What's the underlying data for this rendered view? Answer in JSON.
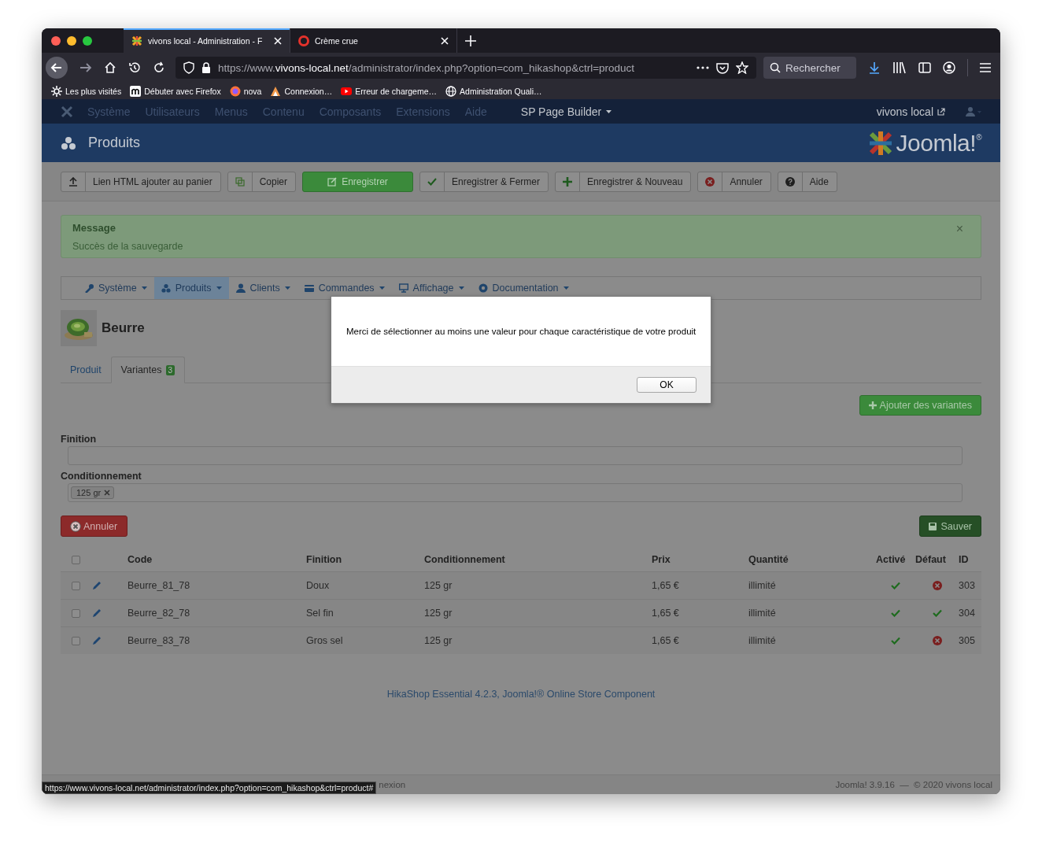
{
  "browser": {
    "tabs": [
      {
        "title": "vivons local - Administration - F",
        "selected": true
      },
      {
        "title": "Crème crue",
        "selected": false
      }
    ],
    "url": "https://www.**vivons-local.net**/administrator/index.php?option=com_hikashop&ctrl=product",
    "search": {
      "placeholder": "Rechercher"
    },
    "bookmarks": [
      "Les plus visités",
      "Débuter avec Firefox",
      "nova",
      "Connexion…",
      "Erreur de chargeme…",
      "Administration Quali…"
    ]
  },
  "admin_menu": {
    "items": [
      {
        "label": "Système",
        "disabled": true,
        "dropdown": false
      },
      {
        "label": "Utilisateurs",
        "disabled": true,
        "dropdown": false
      },
      {
        "label": "Menus",
        "disabled": true,
        "dropdown": false
      },
      {
        "label": "Contenu",
        "disabled": true,
        "dropdown": false
      },
      {
        "label": "Composants",
        "disabled": true,
        "dropdown": false
      },
      {
        "label": "Extensions",
        "disabled": true,
        "dropdown": false
      },
      {
        "label": "Aide",
        "disabled": true,
        "dropdown": false
      },
      {
        "label": "SP Page Builder",
        "disabled": false,
        "dropdown": true
      }
    ],
    "site_link": "vivons local"
  },
  "header": {
    "title": "Produits",
    "logo": "Joomla!$^{®}$"
  },
  "toolbar": [
    {
      "label": "Lien HTML ajouter au panier",
      "kind": "default"
    },
    {
      "label": "Copier",
      "kind": "default"
    },
    {
      "label": "Enregistrer",
      "kind": "primary"
    },
    {
      "label": "Enregistrer & Fermer",
      "kind": "default"
    },
    {
      "label": "Enregistrer & Nouveau",
      "kind": "default"
    },
    {
      "label": "Annuler",
      "kind": "default"
    },
    {
      "label": "Aide",
      "kind": "default"
    }
  ],
  "message": {
    "heading": "Message",
    "text": "Succès de la sauvegarde",
    "close": "×"
  },
  "submenu": [
    {
      "label": "Système",
      "selected": false
    },
    {
      "label": "Produits",
      "selected": true
    },
    {
      "label": "Clients",
      "selected": false
    },
    {
      "label": "Commandes",
      "selected": false
    },
    {
      "label": "Affichage",
      "selected": false
    },
    {
      "label": "Documentation",
      "selected": false
    }
  ],
  "product": {
    "name": "Beurre"
  },
  "tabs": [
    {
      "label": "Produit",
      "selected": false
    },
    {
      "label": "Variantes",
      "selected": true,
      "badge": "3"
    }
  ],
  "add_variants_button": "Ajouter des variantes",
  "characteristics": [
    {
      "label": "Finition"
    },
    {
      "label": "Conditionnement",
      "tags": [
        "125 gr"
      ]
    }
  ],
  "cancel_button": "Annuler",
  "save_button": "Sauver",
  "table": {
    "all_checked": false,
    "columns": [
      "Code",
      "Finition",
      "Conditionnement",
      "Prix",
      "Quantité",
      "Activé",
      "Défaut",
      "ID"
    ],
    "rows": [
      {
        "checked": false,
        "code": "Beurre_81_78",
        "finition": "Doux",
        "conditionnement": "125 gr",
        "prix": "1,65 €",
        "quantite": "illimité",
        "active": true,
        "default": false,
        "id": "303"
      },
      {
        "checked": false,
        "code": "Beurre_82_78",
        "finition": "Sel fin",
        "conditionnement": "125 gr",
        "prix": "1,65 €",
        "quantite": "illimité",
        "active": true,
        "default": true,
        "id": "304"
      },
      {
        "checked": false,
        "code": "Beurre_83_78",
        "finition": "Gros sel",
        "conditionnement": "125 gr",
        "prix": "1,65 €",
        "quantite": "illimité",
        "active": true,
        "default": false,
        "id": "305"
      }
    ]
  },
  "footer_link": "HikaShop Essential 4.2.3, Joomla!® Online Store Component",
  "status_bar": {
    "left": "nexion",
    "right": "Joomla! 3.9.16  —  © 2020 vivons local"
  },
  "link_preview": "https://www.vivons-local.net/administrator/index.php?option=com_hikashop&ctrl=product#",
  "dialog": {
    "message": "Merci de sélectionner au moins une valeur pour chaque caractéristique de votre produit",
    "button": "OK"
  }
}
